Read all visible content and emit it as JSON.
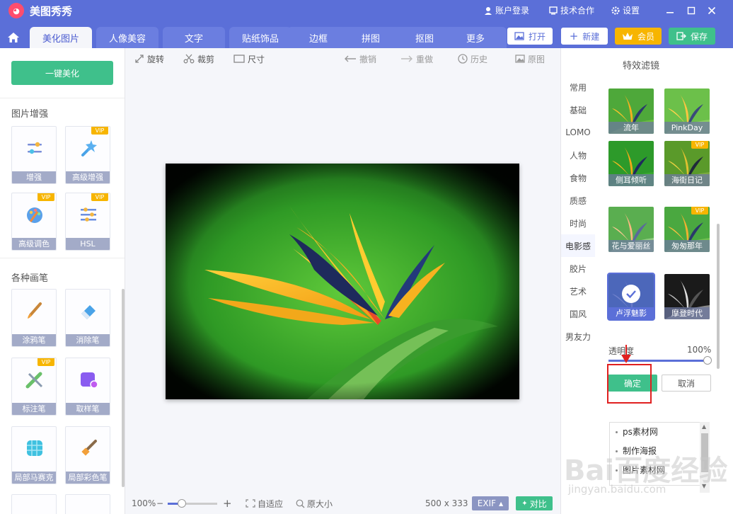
{
  "app": {
    "title": "美图秀秀",
    "login": "账户登录",
    "cooperation": "技术合作",
    "settings": "设置"
  },
  "tabs": [
    "美化图片",
    "人像美容",
    "文字",
    "贴纸饰品",
    "边框",
    "拼图",
    "抠图",
    "更多"
  ],
  "actions": {
    "open": "打开",
    "new": "新建",
    "member": "会员",
    "save": "保存"
  },
  "left": {
    "one_key": "一键美化",
    "section_enhance": "图片增强",
    "section_brush": "各种画笔",
    "vip_badge": "VIP",
    "tools": [
      {
        "label": "增强"
      },
      {
        "label": "高级增强"
      },
      {
        "label": "高级调色"
      },
      {
        "label": "HSL"
      },
      {
        "label": "涂鸦笔"
      },
      {
        "label": "消除笔"
      },
      {
        "label": "标注笔"
      },
      {
        "label": "取样笔"
      },
      {
        "label": "局部马赛克"
      },
      {
        "label": "局部彩色笔"
      }
    ]
  },
  "toolbar": {
    "rotate": "旋转",
    "crop": "裁剪",
    "size": "尺寸",
    "undo": "撤销",
    "redo": "重做",
    "history": "历史",
    "original": "原图"
  },
  "status": {
    "zoom": "100%",
    "fit": "自适应",
    "actual_size": "原大小",
    "dimensions": "500 x 333",
    "exif": "EXIF",
    "compare": "对比"
  },
  "right": {
    "title": "特效滤镜",
    "categories": [
      "常用",
      "基础",
      "LOMO",
      "人物",
      "食物",
      "质感",
      "时尚",
      "电影感",
      "胶片",
      "艺术",
      "国风",
      "男友力"
    ],
    "active_category": "电影感",
    "filters": [
      {
        "label": "流年"
      },
      {
        "label": "PinkDay"
      },
      {
        "label": "侧耳倾听"
      },
      {
        "label": "海街日记"
      },
      {
        "label": "花与爱丽丝"
      },
      {
        "label": "匆匆那年"
      },
      {
        "label": "卢浮魅影"
      },
      {
        "label": "摩登时代"
      }
    ],
    "transparency_label": "透明度",
    "transparency_value": "100%",
    "transparency": 1.0,
    "ok": "确定",
    "cancel": "取消",
    "list_items": [
      "ps素材网",
      "制作海报",
      "图片素材网"
    ]
  },
  "watermark": {
    "main": "Bai百度经验",
    "sub": "jingyan.baidu.com"
  },
  "colors": {
    "header": "#5b6fd8",
    "accent_green": "#3fc08b",
    "member_gold": "#f7b500",
    "highlight_red": "#e02020"
  }
}
